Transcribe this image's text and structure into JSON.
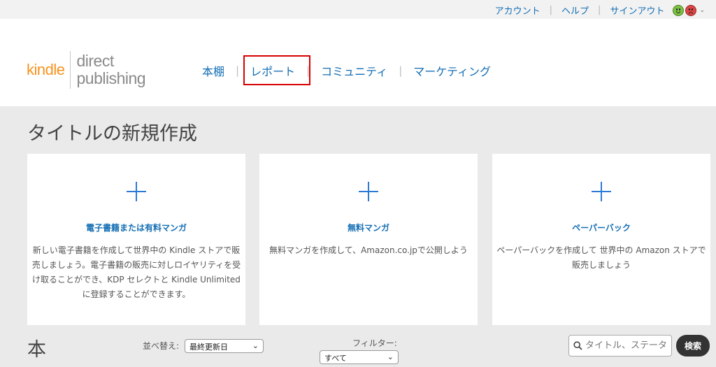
{
  "topbar": {
    "account": "アカウント",
    "help": "ヘルプ",
    "signout": "サインアウト",
    "sep": "|"
  },
  "logo": {
    "kindle": "kindle",
    "direct": "direct",
    "publishing": "publishing"
  },
  "nav": {
    "bookshelf": "本棚",
    "reports": "レポート",
    "community": "コミュニティ",
    "marketing": "マーケティング",
    "sep": "|"
  },
  "page_title": "タイトルの新規作成",
  "cards": [
    {
      "title": "電子書籍または有料マンガ",
      "description": "新しい電子書籍を作成して世界中の Kindle ストアで販売しましょう。電子書籍の販売に対しロイヤリティを受け取ることができ、KDP セレクトと Kindle Unlimited に登録することができます。"
    },
    {
      "title": "無料マンガ",
      "description": "無料マンガを作成して、Amazon.co.jpで公開しよう"
    },
    {
      "title": "ペーパーバック",
      "description": "ペーパーバックを作成して 世界中の Amazon ストアで販売しましょう"
    }
  ],
  "books": {
    "title": "本",
    "sort_label": "並べ替え:",
    "sort_value": "最終更新日",
    "filter_label": "フィルター:",
    "filter_value": "すべて",
    "search_placeholder": "タイトル、ステータ",
    "search_button": "検索"
  },
  "colors": {
    "link": "#146eb4",
    "kindle_orange": "#f7931e",
    "highlight": "#d80000",
    "plus": "#2b7bd6"
  },
  "icons": [
    "happy-face-icon",
    "sad-face-icon",
    "chevron-down-icon",
    "plus-icon",
    "search-icon"
  ]
}
